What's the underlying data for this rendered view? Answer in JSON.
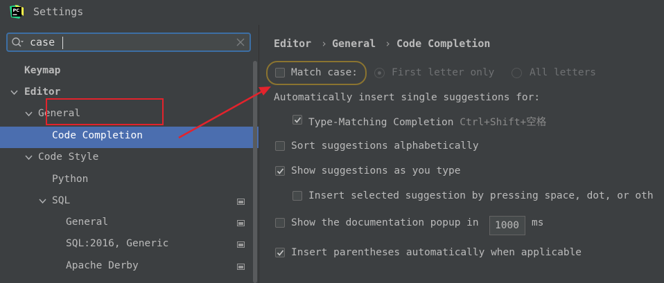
{
  "window": {
    "title": "Settings",
    "logo_text": "PC"
  },
  "search": {
    "value": "case",
    "placeholder": ""
  },
  "tree": {
    "items": [
      {
        "label": "Keymap"
      },
      {
        "label": "Editor"
      },
      {
        "label": "General"
      },
      {
        "label": "Code Completion"
      },
      {
        "label": "Code Style"
      },
      {
        "label": "Python"
      },
      {
        "label": "SQL"
      },
      {
        "label": "General"
      },
      {
        "label": "SQL:2016, Generic"
      },
      {
        "label": "Apache Derby"
      }
    ]
  },
  "breadcrumb": {
    "items": [
      "Editor",
      "General",
      "Code Completion"
    ],
    "separator": "›"
  },
  "settings": {
    "match_case": {
      "label": "Match case:",
      "checked": false
    },
    "first_letter_only": {
      "label": "First letter only",
      "selected": true
    },
    "all_letters": {
      "label": "All letters",
      "selected": false
    },
    "auto_insert_heading": "Automatically insert single suggestions for:",
    "type_matching": {
      "label": "Type-Matching Completion",
      "shortcut": "Ctrl+Shift+空格",
      "checked": true
    },
    "sort_alpha": {
      "label": "Sort suggestions alphabetically",
      "checked": false
    },
    "show_as_type": {
      "label": "Show suggestions as you type",
      "checked": true
    },
    "insert_selected": {
      "label": "Insert selected suggestion by pressing space, dot, or oth",
      "checked": false
    },
    "doc_popup": {
      "label": "Show the documentation popup in",
      "value": "1000",
      "unit": "ms",
      "checked": false
    },
    "insert_parens": {
      "label": "Insert parentheses automatically when applicable",
      "checked": true
    }
  },
  "colors": {
    "selection": "#4b6eaf",
    "annotation_red": "#e3232c",
    "match_outline": "#8b7430",
    "search_border": "#3d6fa5"
  }
}
